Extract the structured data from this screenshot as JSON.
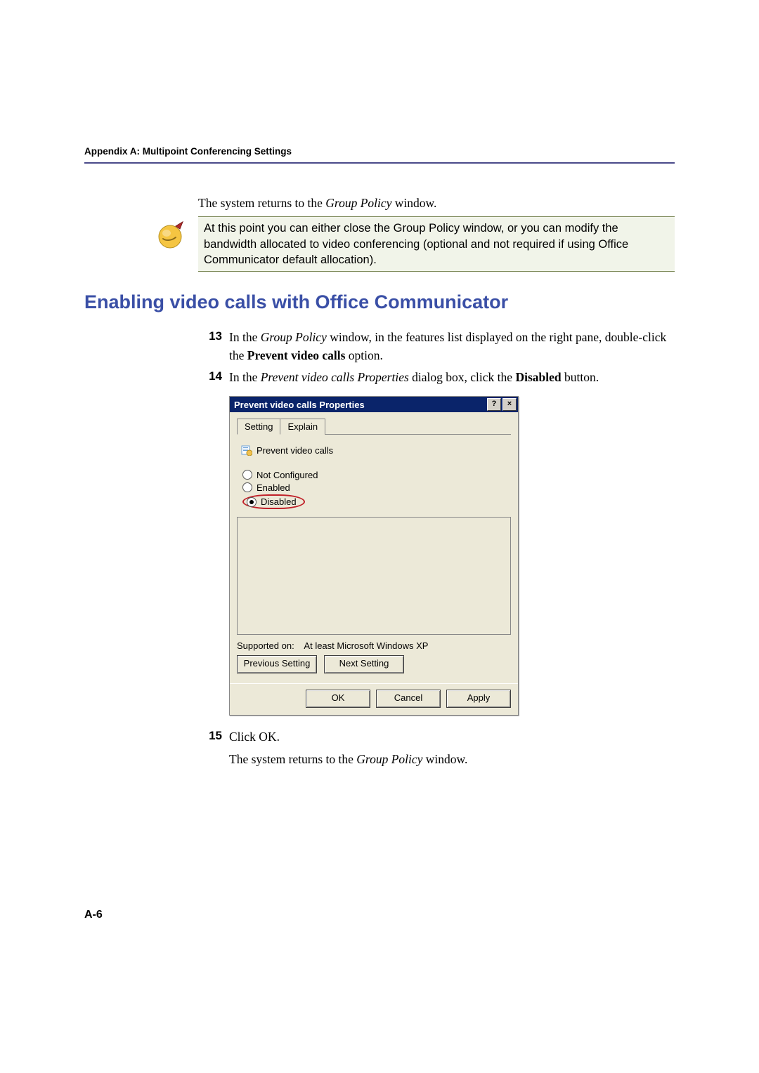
{
  "header": "Appendix A: Multipoint Conferencing Settings",
  "intro_before": "The system returns to the ",
  "intro_italic": "Group Policy",
  "intro_after": " window.",
  "note": "At this point you can either close the Group Policy window, or you can modify the bandwidth allocated to video conferencing (optional and not required if using Office Communicator default allocation).",
  "section_title": "Enabling video calls with Office Communicator",
  "steps": {
    "s13": {
      "num": "13",
      "a1": "In the ",
      "a2_italic": "Group Policy",
      "a3": " window, in the features list displayed on the right pane, double-click the ",
      "a4_bold": "Prevent video calls",
      "a5": " option."
    },
    "s14": {
      "num": "14",
      "a1": "In the ",
      "a2_italic": "Prevent video calls Properties",
      "a3": " dialog box, click the ",
      "a4_bold": "Disabled",
      "a5": " button."
    },
    "s15": {
      "num": "15",
      "a1": "Click OK."
    }
  },
  "post_before": "The system returns to the ",
  "post_italic": "Group Policy",
  "post_after": " window.",
  "dialog": {
    "title": "Prevent video calls Properties",
    "tabs": {
      "setting": "Setting",
      "explain": "Explain"
    },
    "policy_label": "Prevent video calls",
    "radios": {
      "not_configured": "Not Configured",
      "enabled": "Enabled",
      "disabled": "Disabled"
    },
    "supported_label": "Supported on:",
    "supported_value": "At least Microsoft Windows XP",
    "prev": "Previous Setting",
    "next": "Next Setting",
    "ok": "OK",
    "cancel": "Cancel",
    "apply": "Apply"
  },
  "page_number": "A-6"
}
